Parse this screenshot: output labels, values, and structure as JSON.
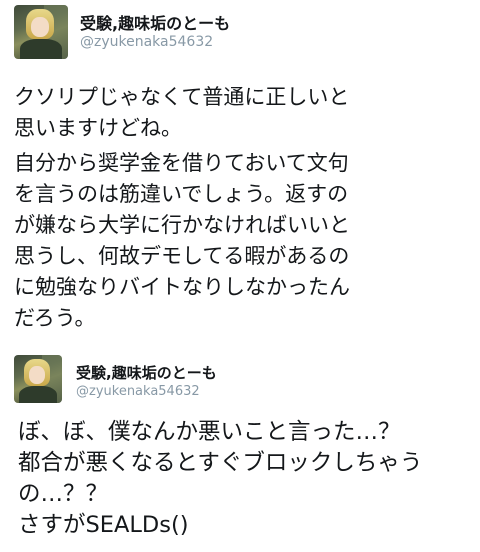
{
  "tweets": [
    {
      "display_name": "受験,趣味垢のとーも",
      "handle": "@zyukenaka54632",
      "lines": [
        "クソリプじゃなくて普通に正しいと",
        "思いますけどね。",
        "自分から奨学金を借りておいて文句",
        "を言うのは筋違いでしょう。返すの",
        "が嫌なら大学に行かなければいいと",
        "思うし、何故デモしてる暇があるの",
        "に勉強なりバイトなりしなかったん",
        "だろう。"
      ]
    },
    {
      "display_name": "受験,趣味垢のとーも",
      "handle": "@zyukenaka54632",
      "lines": [
        "ぼ、ぼ、僕なんか悪いこと言った…？",
        "都合が悪くなるとすぐブロックしちゃう",
        "の…？？",
        "さすがSEALDs()"
      ]
    }
  ]
}
